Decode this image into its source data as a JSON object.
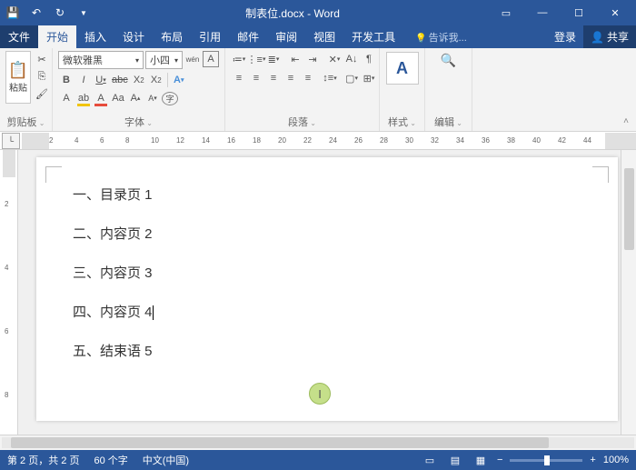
{
  "titlebar": {
    "doc_title": "制表位.docx - Word"
  },
  "tabs": {
    "file": "文件",
    "home": "开始",
    "insert": "插入",
    "design": "设计",
    "layout": "布局",
    "references": "引用",
    "mailings": "邮件",
    "review": "审阅",
    "view": "视图",
    "developer": "开发工具",
    "tell_me": "告诉我...",
    "login": "登录",
    "share": "共享"
  },
  "ribbon": {
    "clipboard": {
      "label": "剪贴板",
      "paste": "粘贴"
    },
    "font": {
      "label": "字体",
      "name": "微软雅黑",
      "size": "小四",
      "bold": "B",
      "italic": "I",
      "underline": "U",
      "strike": "abc",
      "sub": "X",
      "sup": "X",
      "pinyin": "wén",
      "charborder": "A",
      "clear": "A",
      "highlight": "ab",
      "color": "A",
      "circled": "A",
      "grow": "A",
      "shrink": "A",
      "change_case": "Aa"
    },
    "paragraph": {
      "label": "段落"
    },
    "styles": {
      "label": "样式",
      "icon": "A"
    },
    "editing": {
      "label": "编辑"
    }
  },
  "ruler": {
    "marks": [
      "2",
      "4",
      "6",
      "8",
      "10",
      "12",
      "14",
      "16",
      "18",
      "20",
      "22",
      "24",
      "26",
      "28",
      "30",
      "32",
      "34",
      "36",
      "38",
      "40",
      "42",
      "44"
    ]
  },
  "vruler": {
    "marks": [
      "2",
      "4",
      "6",
      "8"
    ]
  },
  "document": {
    "lines": [
      "一、目录页 1",
      "二、内容页 2",
      "三、内容页 3",
      "四、内容页 4",
      "五、结束语 5"
    ],
    "cursor_line": 3
  },
  "status": {
    "page": "第 2 页，共 2 页",
    "words": "60 个字",
    "language": "中文(中国)",
    "zoom": "100%"
  }
}
